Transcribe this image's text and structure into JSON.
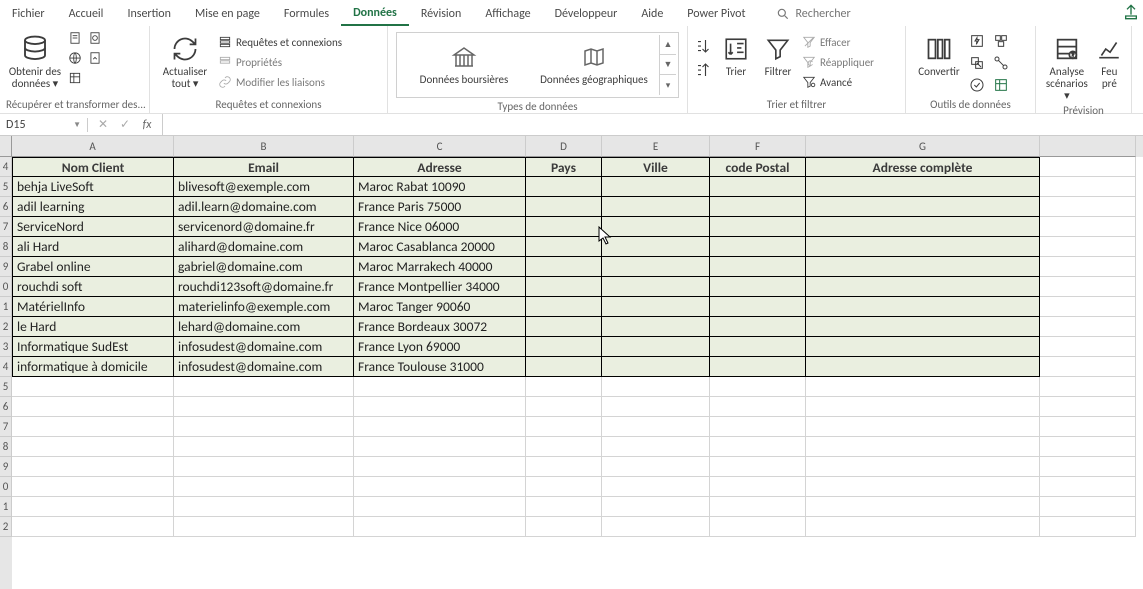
{
  "tabs": {
    "fichier": "Fichier",
    "accueil": "Accueil",
    "insertion": "Insertion",
    "mise_en_page": "Mise en page",
    "formules": "Formules",
    "donnees": "Données",
    "revision": "Révision",
    "affichage": "Affichage",
    "developpeur": "Développeur",
    "aide": "Aide",
    "power_pivot": "Power Pivot"
  },
  "search_placeholder": "Rechercher",
  "ribbon": {
    "get_data": "Obtenir des données",
    "group1": "Récupérer et transformer des...",
    "refresh_all": "Actualiser tout",
    "queries_conn": "Requêtes et connexions",
    "properties": "Propriétés",
    "edit_links": "Modifier les liaisons",
    "group2": "Requêtes et connexions",
    "stocks": "Données boursières",
    "geography": "Données géographiques",
    "group3": "Types de données",
    "sort": "Trier",
    "filter": "Filtrer",
    "clear": "Effacer",
    "reapply": "Réappliquer",
    "advanced": "Avancé",
    "group4": "Trier et filtrer",
    "convert": "Convertir",
    "group5": "Outils de données",
    "analysis": "Analyse scénarios",
    "forecast": "Feu pré",
    "group6": "Prévision"
  },
  "name_box": "D15",
  "columns": [
    "A",
    "B",
    "C",
    "D",
    "E",
    "F",
    "G",
    ""
  ],
  "row_nums": [
    "4",
    "5",
    "6",
    "7",
    "8",
    "9",
    "0",
    "1",
    "2",
    "3",
    "4",
    "5",
    "6",
    "7",
    "8",
    "9",
    "0",
    "1",
    "2"
  ],
  "headers": {
    "nom": "Nom Client",
    "email": "Email",
    "adresse": "Adresse",
    "pays": "Pays",
    "ville": "Ville",
    "postal": "code Postal",
    "complete": "Adresse complète"
  },
  "rows": [
    {
      "nom": "behja LiveSoft",
      "email": "blivesoft@exemple.com",
      "adresse": "Maroc Rabat 10090"
    },
    {
      "nom": "adil learning",
      "email": "adil.learn@domaine.com",
      "adresse": "France Paris 75000"
    },
    {
      "nom": "ServiceNord",
      "email": "servicenord@domaine.fr",
      "adresse": "France Nice 06000"
    },
    {
      "nom": "ali Hard",
      "email": "alihard@domaine.com",
      "adresse": "Maroc Casablanca 20000"
    },
    {
      "nom": "Grabel online",
      "email": "gabriel@domaine.com",
      "adresse": "Maroc Marrakech 40000"
    },
    {
      "nom": "rouchdi soft",
      "email": "rouchdi123soft@domaine.fr",
      "adresse": "France Montpellier 34000"
    },
    {
      "nom": "MatérielInfo",
      "email": "materielinfo@exemple.com",
      "adresse": "Maroc Tanger 90060"
    },
    {
      "nom": "le Hard",
      "email": "lehard@domaine.com",
      "adresse": "France Bordeaux 30072"
    },
    {
      "nom": "Informatique SudEst",
      "email": "infosudest@domaine.com",
      "adresse": "France Lyon 69000"
    },
    {
      "nom": "informatique à domicile",
      "email": "infosudest@domaine.com",
      "adresse": "France Toulouse 31000"
    }
  ]
}
